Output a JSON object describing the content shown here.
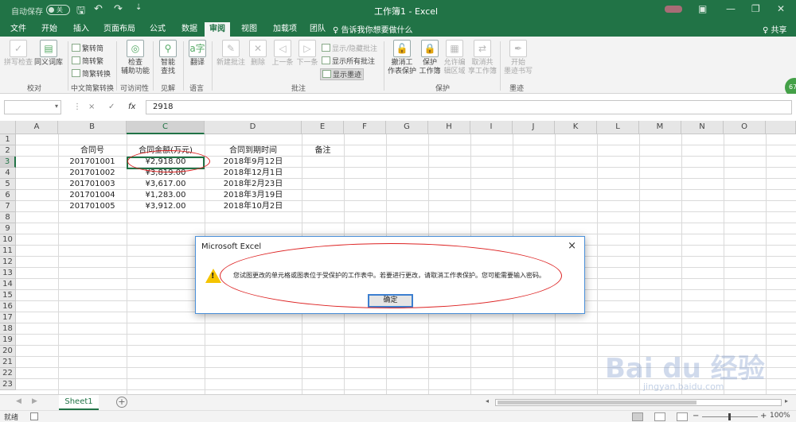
{
  "titlebar": {
    "autosave_label": "自动保存",
    "autosave_toggle": "关",
    "title": "工作簿1  -  Excel"
  },
  "tabs": [
    "文件",
    "开始",
    "插入",
    "页面布局",
    "公式",
    "数据",
    "审阅",
    "视图",
    "加载项",
    "团队"
  ],
  "active_tab": "审阅",
  "tell_me": "♀ 告诉我你想要做什么",
  "share_label": "♀ 共享",
  "ribbon": {
    "spelling": "拼写检查",
    "thesaurus": "同义词库",
    "group_proofing": "校对",
    "to_traditional": "繁转简",
    "to_simplified": "简转繁",
    "convert": "简繁转换",
    "group_chinese": "中文简繁转换",
    "accessibility_1": "检查",
    "accessibility_2": "辅助功能",
    "group_accessibility": "可访问性",
    "smart_lookup_1": "智能",
    "smart_lookup_2": "查找",
    "group_insights": "见解",
    "translate": "翻译",
    "group_language": "语言",
    "new_comment": "新建批注",
    "delete": "删除",
    "previous": "上一条",
    "next": "下一条",
    "show_hide_comment": "显示/隐藏批注",
    "show_all_comments": "显示所有批注",
    "show_ink": "显示墨迹",
    "group_comments": "批注",
    "unprotect_sheet_1": "撤消工",
    "unprotect_sheet_2": "作表保护",
    "protect_workbook_1": "保护",
    "protect_workbook_2": "工作簿",
    "allow_edit_1": "允许编",
    "allow_edit_2": "辑区域",
    "unshare_1": "取消共",
    "unshare_2": "享工作簿",
    "group_protect": "保护",
    "start_ink_1": "开始",
    "start_ink_2": "墨迹书写",
    "group_ink": "墨迹",
    "account_badge": "67"
  },
  "formula_bar": {
    "name_box": "",
    "cancel": "×",
    "enter": "✓",
    "fx": "fx",
    "value": "2918"
  },
  "columns": [
    "A",
    "B",
    "C",
    "D",
    "E",
    "F",
    "G",
    "H",
    "I",
    "J",
    "K",
    "L",
    "M",
    "N",
    "O"
  ],
  "rows": [
    "1",
    "2",
    "3",
    "4",
    "5",
    "6",
    "7",
    "8",
    "9",
    "10",
    "11",
    "12",
    "13",
    "14",
    "15",
    "16",
    "17",
    "18",
    "19",
    "20",
    "21",
    "22",
    "23"
  ],
  "table": {
    "headers": {
      "B": "合同号",
      "C": "合同金额(万元)",
      "D": "合同到期时间",
      "E": "备注"
    },
    "data": [
      {
        "B": "201701001",
        "C": "¥2,918.00",
        "D": "2018年9月12日"
      },
      {
        "B": "201701002",
        "C": "¥3,819.00",
        "D": "2018年12月1日"
      },
      {
        "B": "201701003",
        "C": "¥3,617.00",
        "D": "2018年2月23日"
      },
      {
        "B": "201701004",
        "C": "¥1,283.00",
        "D": "2018年3月19日"
      },
      {
        "B": "201701005",
        "C": "¥3,912.00",
        "D": "2018年10月2日"
      }
    ]
  },
  "dialog": {
    "title": "Microsoft Excel",
    "close": "×",
    "message": "您试图更改的单元格或图表位于受保护的工作表中。若要进行更改，请取消工作表保护。您可能需要输入密码。",
    "ok": "确定"
  },
  "sheet_tabs": [
    "Sheet1"
  ],
  "add_sheet": "+",
  "status": {
    "ready": "就绪",
    "zoom_out": "−",
    "zoom_in": "+",
    "zoom": "100%"
  },
  "watermark": {
    "text": "Bai du 经验",
    "url": "jingyan.baidu.com"
  }
}
